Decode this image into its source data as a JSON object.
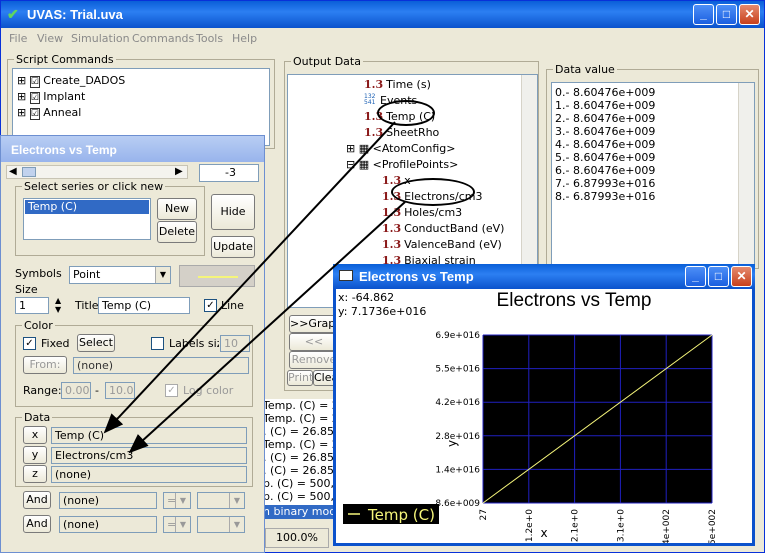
{
  "main_window": {
    "title": "UVAS: Trial.uva",
    "menu": [
      "File",
      "View",
      "Simulation",
      "Commands",
      "Tools",
      "Help"
    ]
  },
  "script_commands": {
    "label": "Script Commands",
    "items": [
      "Create_DADOS",
      "Implant",
      "Anneal"
    ]
  },
  "output_data": {
    "label": "Output Data",
    "items": [
      "Time (s)",
      "Events",
      "Temp (C)",
      "SheetRho",
      "<AtomConfig>",
      "<ProfilePoints>",
      "x",
      "Electrons/cm3",
      "Holes/cm3",
      "ConductBand (eV)",
      "ValenceBand (eV)",
      "Biaxial strain"
    ],
    "events_icon": "132\n541",
    "buttons": [
      ">>Graph",
      "<< Graph",
      "Remove",
      "Print",
      "Clea"
    ]
  },
  "data_value": {
    "label": "Data value",
    "rows": [
      "0.-  8.60476e+009",
      "1.-  8.60476e+009",
      "2.-  8.60476e+009",
      "3.-  8.60476e+009",
      "4.-  8.60476e+009",
      "5.-  8.60476e+009",
      "6.-  8.60476e+009",
      "7.-  6.87993e+016",
      "8.-  6.87993e+016"
    ]
  },
  "log_lines": [
    "Temp. (C) = 26",
    "Temp. (C) = 26",
    ". (C) = 26.85, E",
    "Temp. (C) = 26",
    ". (C) = 26.85, E",
    ". (C) = 26.85, E",
    "p. (C) = 500, Ev",
    "p. (C) = 500, Ev"
  ],
  "status": {
    "mode": "n binary mode",
    "zoom": "100.0%"
  },
  "settings_dialog": {
    "title": "Electrons vs Temp",
    "slider_value": "-3",
    "series_group_label": "Select series or click new",
    "series": [
      "Temp (C)"
    ],
    "new_label": "New",
    "delete_label": "Delete",
    "hide_label": "Hide",
    "update_label": "Update",
    "symbols_label": "Symbols",
    "symbols_value": "Point",
    "size_label": "Size",
    "size_value": "1",
    "title_label": "Title",
    "title_value": "Temp (C)",
    "line_label": "Line",
    "color_group_label": "Color",
    "fixed_label": "Fixed",
    "select_label": "Select",
    "labels_size_label": "Labels size",
    "labels_size_value": "10",
    "from_label": "From:",
    "from_value": "(none)",
    "range_label": "Range:",
    "range_min": "0.00",
    "range_dash": "-",
    "range_max": "10.0",
    "log_color_label": "Log color",
    "data_group_label": "Data",
    "x_label": "x",
    "x_value": "Temp (C)",
    "y_label": "y",
    "y_value": "Electrons/cm3",
    "z_label": "z",
    "z_value": "(none)",
    "and_label": "And",
    "and1_value": "(none)",
    "and1_op": "=",
    "and2_value": "(none)",
    "and2_op": "=",
    "line_color": "#f5f57a"
  },
  "graph_window": {
    "title": "Electrons vs Temp",
    "cursor_x": "x: -64.862",
    "cursor_y": "y: 7.1736e+016",
    "legend": "Temp (C)",
    "chart_data": {
      "type": "line",
      "title": "Electrons vs Temp",
      "xlabel": "x",
      "ylabel": "y",
      "x_ticks": [
        "27",
        "1.2e+0",
        "2.1e+0",
        "3.1e+0",
        "4e+002",
        "5e+002"
      ],
      "y_ticks": [
        "8.6e+009",
        "1.4e+016",
        "2.8e+016",
        "4.2e+016",
        "5.5e+016",
        "6.9e+016"
      ],
      "xlim": [
        27,
        500
      ],
      "ylim": [
        8600000000,
        69000000000000000
      ],
      "grid": true,
      "series": [
        {
          "name": "Temp (C)",
          "x": [
            27,
            500
          ],
          "y": [
            8600000000,
            69000000000000000
          ]
        }
      ],
      "background": "#000000",
      "grid_color": "#2020c0",
      "line_color": "#f5f57a"
    }
  }
}
